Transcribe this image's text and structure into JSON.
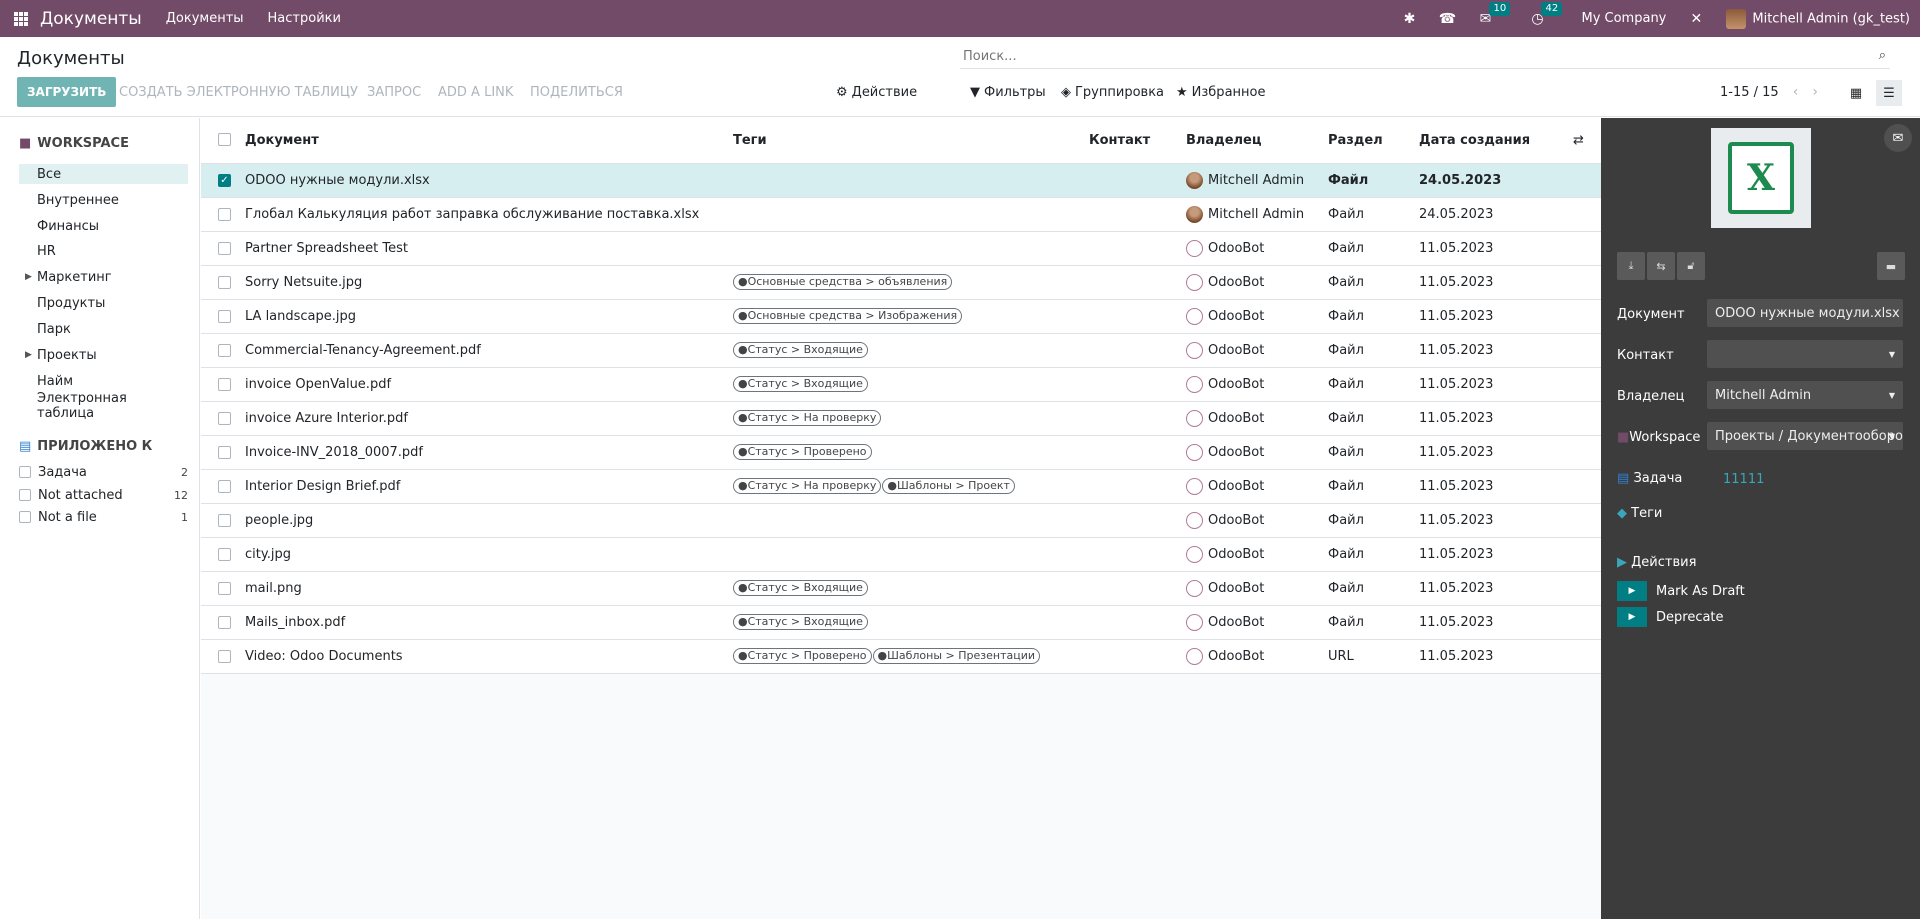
{
  "navbar": {
    "app_title": "Документы",
    "menu": [
      "Документы",
      "Настройки"
    ],
    "chat_count": "10",
    "activity_count": "42",
    "company": "My Company",
    "user": "Mitchell Admin (gk_test)"
  },
  "control_panel": {
    "breadcrumb": "Документы",
    "search_placeholder": "Поиск...",
    "upload": "ЗАГРУЗИТЬ",
    "create_spreadsheet": "СОЗДАТЬ ЭЛЕКТРОННУЮ ТАБЛИЦУ",
    "request": "ЗАПРОС",
    "add_link": "ADD A LINK",
    "share": "ПОДЕЛИТЬСЯ",
    "action": "Действие",
    "filters": "Фильтры",
    "group_by": "Группировка",
    "favorites": "Избранное",
    "pager": "1-15 / 15"
  },
  "sidebar": {
    "workspace_title": "WORKSPACE",
    "items": [
      {
        "label": "Все",
        "active": true,
        "caret": false
      },
      {
        "label": "Внутреннее",
        "active": false,
        "caret": false
      },
      {
        "label": "Финансы",
        "active": false,
        "caret": false
      },
      {
        "label": "HR",
        "active": false,
        "caret": false
      },
      {
        "label": "Маркетинг",
        "active": false,
        "caret": true
      },
      {
        "label": "Продукты",
        "active": false,
        "caret": false
      },
      {
        "label": "Парк",
        "active": false,
        "caret": false
      },
      {
        "label": "Проекты",
        "active": false,
        "caret": true
      },
      {
        "label": "Найм",
        "active": false,
        "caret": false
      },
      {
        "label": "Электронная таблица",
        "active": false,
        "caret": false
      }
    ],
    "attached_title": "ПРИЛОЖЕНО К",
    "filters": [
      {
        "label": "Задача",
        "count": "2"
      },
      {
        "label": "Not attached",
        "count": "12"
      },
      {
        "label": "Not a file",
        "count": "1"
      }
    ]
  },
  "table": {
    "headers": {
      "document": "Документ",
      "tags": "Теги",
      "contact": "Контакт",
      "owner": "Владелец",
      "type": "Раздел",
      "created": "Дата создания"
    },
    "rows": [
      {
        "name": "ODOO нужные модули.xlsx",
        "tags": [],
        "owner": "Mitchell Admin",
        "owner_type": "admin",
        "type": "Файл",
        "date": "24.05.2023",
        "selected": true
      },
      {
        "name": "Глобал Калькуляция работ заправка обслуживание поставка.xlsx",
        "tags": [],
        "owner": "Mitchell Admin",
        "owner_type": "admin",
        "type": "Файл",
        "date": "24.05.2023",
        "selected": false
      },
      {
        "name": "Partner Spreadsheet Test",
        "tags": [],
        "owner": "OdooBot",
        "owner_type": "bot",
        "type": "Файл",
        "date": "11.05.2023",
        "selected": false
      },
      {
        "name": "Sorry Netsuite.jpg",
        "tags": [
          "●Основные средства > объявления"
        ],
        "owner": "OdooBot",
        "owner_type": "bot",
        "type": "Файл",
        "date": "11.05.2023",
        "selected": false
      },
      {
        "name": "LA landscape.jpg",
        "tags": [
          "●Основные средства > Изображения"
        ],
        "owner": "OdooBot",
        "owner_type": "bot",
        "type": "Файл",
        "date": "11.05.2023",
        "selected": false
      },
      {
        "name": "Commercial-Tenancy-Agreement.pdf",
        "tags": [
          "●Статус > Входящие"
        ],
        "owner": "OdooBot",
        "owner_type": "bot",
        "type": "Файл",
        "date": "11.05.2023",
        "selected": false
      },
      {
        "name": "invoice OpenValue.pdf",
        "tags": [
          "●Статус > Входящие"
        ],
        "owner": "OdooBot",
        "owner_type": "bot",
        "type": "Файл",
        "date": "11.05.2023",
        "selected": false
      },
      {
        "name": "invoice Azure Interior.pdf",
        "tags": [
          "●Статус > На проверку"
        ],
        "owner": "OdooBot",
        "owner_type": "bot",
        "type": "Файл",
        "date": "11.05.2023",
        "selected": false
      },
      {
        "name": "Invoice-INV_2018_0007.pdf",
        "tags": [
          "●Статус > Проверено"
        ],
        "owner": "OdooBot",
        "owner_type": "bot",
        "type": "Файл",
        "date": "11.05.2023",
        "selected": false
      },
      {
        "name": "Interior Design Brief.pdf",
        "tags": [
          "●Статус > На проверку",
          "●Шаблоны > Проект"
        ],
        "owner": "OdooBot",
        "owner_type": "bot",
        "type": "Файл",
        "date": "11.05.2023",
        "selected": false
      },
      {
        "name": "people.jpg",
        "tags": [],
        "owner": "OdooBot",
        "owner_type": "bot",
        "type": "Файл",
        "date": "11.05.2023",
        "selected": false
      },
      {
        "name": "city.jpg",
        "tags": [],
        "owner": "OdooBot",
        "owner_type": "bot",
        "type": "Файл",
        "date": "11.05.2023",
        "selected": false
      },
      {
        "name": "mail.png",
        "tags": [
          "●Статус > Входящие"
        ],
        "owner": "OdooBot",
        "owner_type": "bot",
        "type": "Файл",
        "date": "11.05.2023",
        "selected": false
      },
      {
        "name": "Mails_inbox.pdf",
        "tags": [
          "●Статус > Входящие"
        ],
        "owner": "OdooBot",
        "owner_type": "bot",
        "type": "Файл",
        "date": "11.05.2023",
        "selected": false
      },
      {
        "name": "Video: Odoo Documents",
        "tags": [
          "●Статус > Проверено",
          "●Шаблоны > Презентации"
        ],
        "owner": "OdooBot",
        "owner_type": "bot",
        "type": "URL",
        "date": "11.05.2023",
        "selected": false
      }
    ]
  },
  "details": {
    "thumbnail_letter": "X",
    "document_label": "Документ",
    "document_value": "ODOO нужные модули.xlsx",
    "contact_label": "Контакт",
    "contact_value": "",
    "owner_label": "Владелец",
    "owner_value": "Mitchell Admin",
    "workspace_label": "Workspace",
    "workspace_value": "Проекты / Документооборот",
    "task_label": "Задача",
    "task_value": "11111",
    "tags_label": "Теги",
    "actions_title": "Действия",
    "actions": [
      "Mark As Draft",
      "Deprecate"
    ]
  },
  "colors": {
    "navbar": "#714b67",
    "accent": "#017e84",
    "upload_button": "#71b4b4",
    "selected_row": "#d7eef0",
    "panel": "#3c3c3c"
  }
}
